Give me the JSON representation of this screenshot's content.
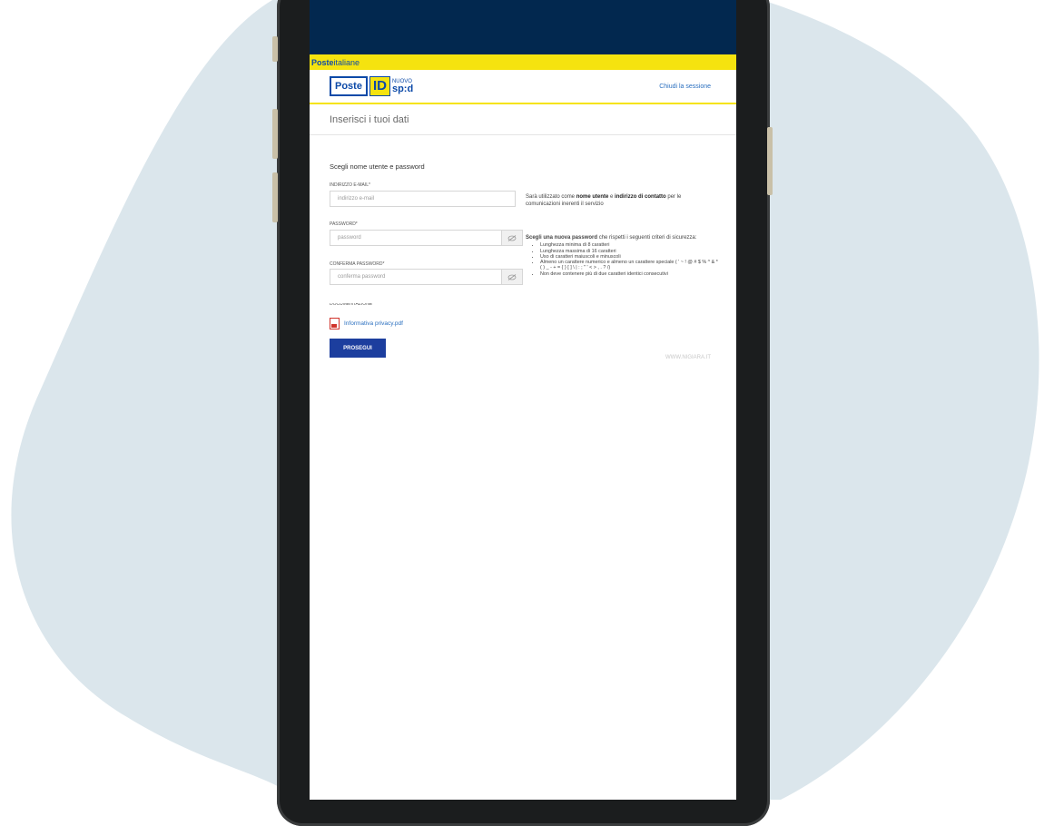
{
  "colors": {
    "background_blob": "#dbe6ec",
    "status_bar": "#02284f",
    "brand_yellow": "#f5e30f",
    "brand_blue": "#0d4aa8",
    "button": "#1c3e9e"
  },
  "brand": {
    "poste_bold": "Poste",
    "poste_regular": "italiane"
  },
  "logo": {
    "poste": "Poste",
    "id": "ID",
    "nuovo": "NUOVO",
    "spid": "sp:d"
  },
  "header": {
    "close_session": "Chiudi la sessione"
  },
  "page": {
    "title": "Inserisci i tuoi dati"
  },
  "form": {
    "section_title": "Scegli nome utente e password",
    "email": {
      "label": "INDIRIZZO E-MAIL*",
      "placeholder": "indirizzo e-mail"
    },
    "email_hint": {
      "pre": "Sarà utilizzato come ",
      "bold1": "nome utente",
      "mid": " e ",
      "bold2": "indirizzo di contatto",
      "post": " per le comunicazioni inerenti il servizio"
    },
    "password": {
      "label": "PASSWORD*",
      "placeholder": "password"
    },
    "confirm": {
      "label": "CONFERMA PASSWORD*",
      "placeholder": "conferma password"
    },
    "criteria": {
      "intro_bold": "Scegli una nuova password",
      "intro_rest": " che rispetti i seguenti criteri di sicurezza:",
      "items": [
        "Lunghezza minima di 8 caratteri",
        "Lunghezza massima di 16 caratteri",
        "Uso di caratteri maiuscoli e minuscoli",
        "Almeno un carattere numerico e almeno un carattere speciale ( ' ~ ! @ # $ % ^ & * ( ) _ - + = { } [ ] \\ | : ; \" ' < > , . ? /)",
        "Non deve contenere più di due caratteri identici consecutivi"
      ]
    },
    "documentation_label": "DOCUMENTAZIONE",
    "privacy_link": "Informativa privacy.pdf",
    "submit": "PROSEGUI"
  },
  "watermark": "WWW.NIGIARA.IT"
}
